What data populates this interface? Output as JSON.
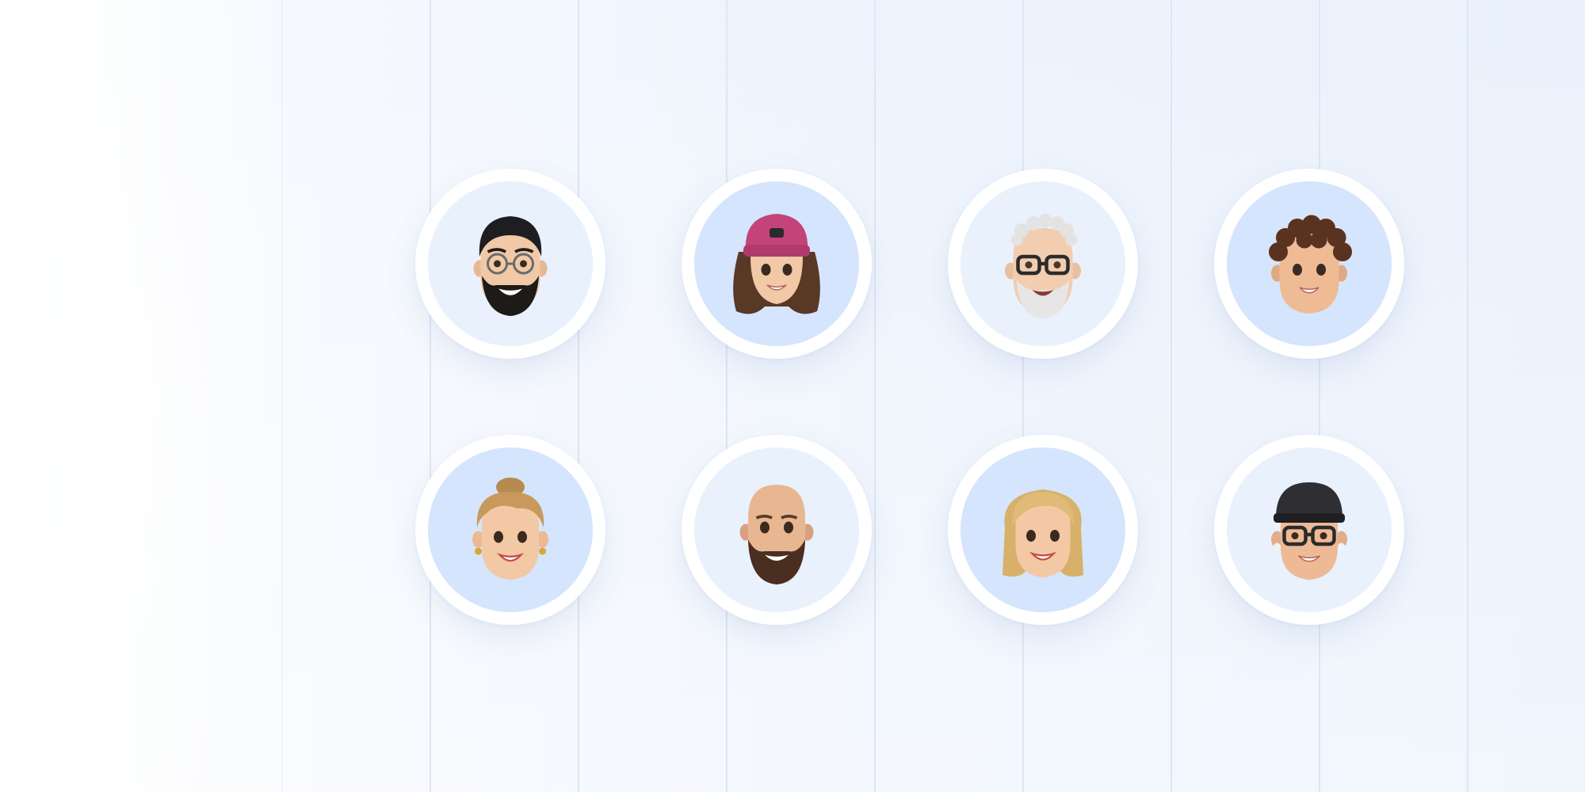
{
  "colors": {
    "accent_line": "#5b8fe6",
    "grid_line": "#dde6f3",
    "avatar_ring": "#ffffff",
    "avatar_bg_light": "#e9f1fd",
    "avatar_bg_blue": "#d4e5fd"
  },
  "avatars": [
    {
      "icon": "memoji-man-glasses-beard-icon",
      "bg": "light"
    },
    {
      "icon": "memoji-woman-pink-beanie-icon",
      "bg": "blue"
    },
    {
      "icon": "memoji-older-man-white-hair-glasses-icon",
      "bg": "light"
    },
    {
      "icon": "memoji-boy-curly-hair-icon",
      "bg": "blue"
    },
    {
      "icon": "memoji-woman-blonde-bun-earrings-icon",
      "bg": "blue"
    },
    {
      "icon": "memoji-bald-man-beard-icon",
      "bg": "light"
    },
    {
      "icon": "memoji-woman-blonde-bob-icon",
      "bg": "blue"
    },
    {
      "icon": "memoji-man-black-cap-glasses-icon",
      "bg": "light"
    }
  ]
}
